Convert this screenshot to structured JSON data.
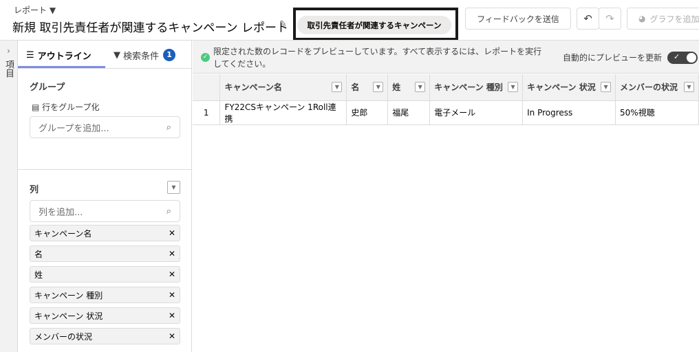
{
  "header": {
    "breadcrumb": "レポート",
    "title": "新規 取引先責任者が関連するキャンペーン レポート",
    "report_type": "取引先責任者が関連するキャンペーン",
    "feedback": "フィードバックを送信",
    "add_chart": "グラフを追加"
  },
  "strip": {
    "label": "項目"
  },
  "panel": {
    "tabs": [
      {
        "label": "アウトライン"
      },
      {
        "label": "検索条件",
        "badge": "1"
      }
    ],
    "group": {
      "title": "グループ",
      "row_group": "行をグループ化",
      "placeholder": "グループを追加..."
    },
    "columns": {
      "title": "列",
      "placeholder": "列を追加...",
      "items": [
        "キャンペーン名",
        "名",
        "姓",
        "キャンペーン 種別",
        "キャンペーン 状況",
        "メンバーの状況"
      ]
    }
  },
  "preview": {
    "message": "限定された数のレコードをプレビューしています。すべて表示するには、レポートを実行してください。",
    "auto_update": "自動的にプレビューを更新",
    "auto_update_on": true
  },
  "table": {
    "headers": [
      "キャンペーン名",
      "名",
      "姓",
      "キャンペーン 種別",
      "キャンペーン 状況",
      "メンバーの状況"
    ],
    "rows": [
      {
        "num": "1",
        "cells": [
          "FY22CSキャンペーン 1Roll連携",
          "史郎",
          "福尾",
          "電子メール",
          "In Progress",
          "50%視聴"
        ]
      }
    ]
  },
  "colors": {
    "accent": "#1b5fbd",
    "tab_underline": "#7f8de1",
    "success": "#4bca81"
  }
}
